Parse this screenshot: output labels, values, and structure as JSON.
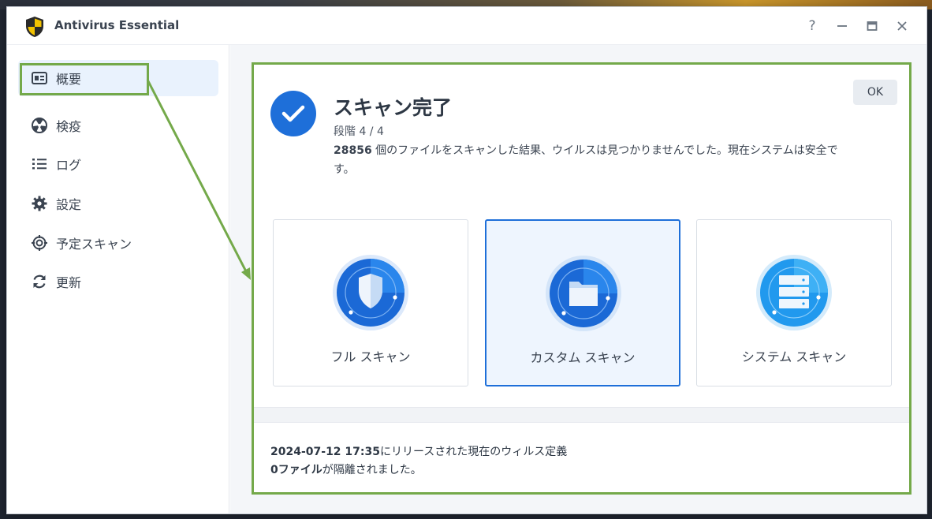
{
  "app": {
    "title": "Antivirus Essential"
  },
  "window_controls": {
    "help": "?",
    "minimize": "—",
    "maximize": "▭",
    "close": "✕"
  },
  "sidebar": {
    "items": [
      {
        "label": "概要",
        "icon": "overview-icon"
      },
      {
        "label": "検疫",
        "icon": "quarantine-icon"
      },
      {
        "label": "ログ",
        "icon": "log-list-icon"
      },
      {
        "label": "設定",
        "icon": "gear-icon"
      },
      {
        "label": "予定スキャン",
        "icon": "target-icon"
      },
      {
        "label": "更新",
        "icon": "refresh-icon"
      }
    ]
  },
  "scan_result": {
    "title": "スキャン完了",
    "stage": "段階 4 / 4",
    "file_count": "28856",
    "message": " 個のファイルをスキャンした結果、ウイルスは見つかりませんでした。現在システムは安全です。",
    "ok_label": "OK"
  },
  "scan_options": [
    {
      "label": "フル スキャン",
      "icon": "shield-icon",
      "selected": false
    },
    {
      "label": "カスタム スキャン",
      "icon": "folder-icon",
      "selected": true
    },
    {
      "label": "システム スキャン",
      "icon": "server-icon",
      "selected": false
    }
  ],
  "definitions": {
    "release_datetime": "2024-07-12 17:35",
    "release_suffix": "にリリースされた現在のウィルス定義",
    "quarantine_count": "0ファイル",
    "quarantine_suffix": "が隔離されました。"
  },
  "colors": {
    "accent": "#1e6fd9",
    "highlight": "#74a94a",
    "sidebar_active": "#e9f2fd"
  }
}
